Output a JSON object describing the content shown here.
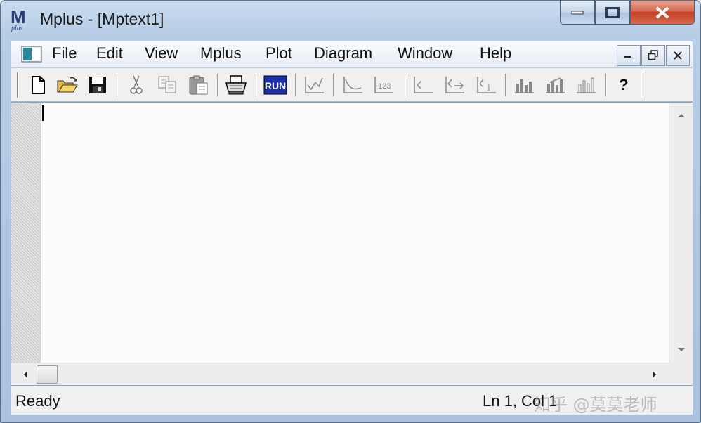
{
  "window": {
    "title": "Mplus - [Mptext1]",
    "app_icon_letter": "M",
    "app_icon_sub": "plus"
  },
  "menubar": {
    "items": [
      "File",
      "Edit",
      "View",
      "Mplus",
      "Plot",
      "Diagram",
      "Window",
      "Help"
    ]
  },
  "toolbar": {
    "buttons": [
      {
        "name": "new-file-icon"
      },
      {
        "name": "open-folder-icon"
      },
      {
        "name": "save-icon"
      },
      {
        "name": "cut-icon"
      },
      {
        "name": "copy-icon"
      },
      {
        "name": "paste-icon"
      },
      {
        "name": "print-icon"
      },
      {
        "name": "run-icon",
        "label": "RUN"
      },
      {
        "name": "plot-icon"
      },
      {
        "name": "plot-curve-icon"
      },
      {
        "name": "plot-values-icon"
      },
      {
        "name": "diagram-icon"
      },
      {
        "name": "diagram-arrow-icon"
      },
      {
        "name": "diagram-info-icon"
      },
      {
        "name": "histogram-icon"
      },
      {
        "name": "histogram-arrow-icon"
      },
      {
        "name": "histogram-bars-icon"
      },
      {
        "name": "help-icon",
        "label": "?"
      }
    ]
  },
  "statusbar": {
    "status": "Ready",
    "position": "Ln 1, Col 1",
    "watermark": "知乎 @莫莫老师"
  },
  "colors": {
    "run_bg": "#1a2fa8",
    "close_red": "#c33f22",
    "frame_blue": "#b6cde6"
  }
}
